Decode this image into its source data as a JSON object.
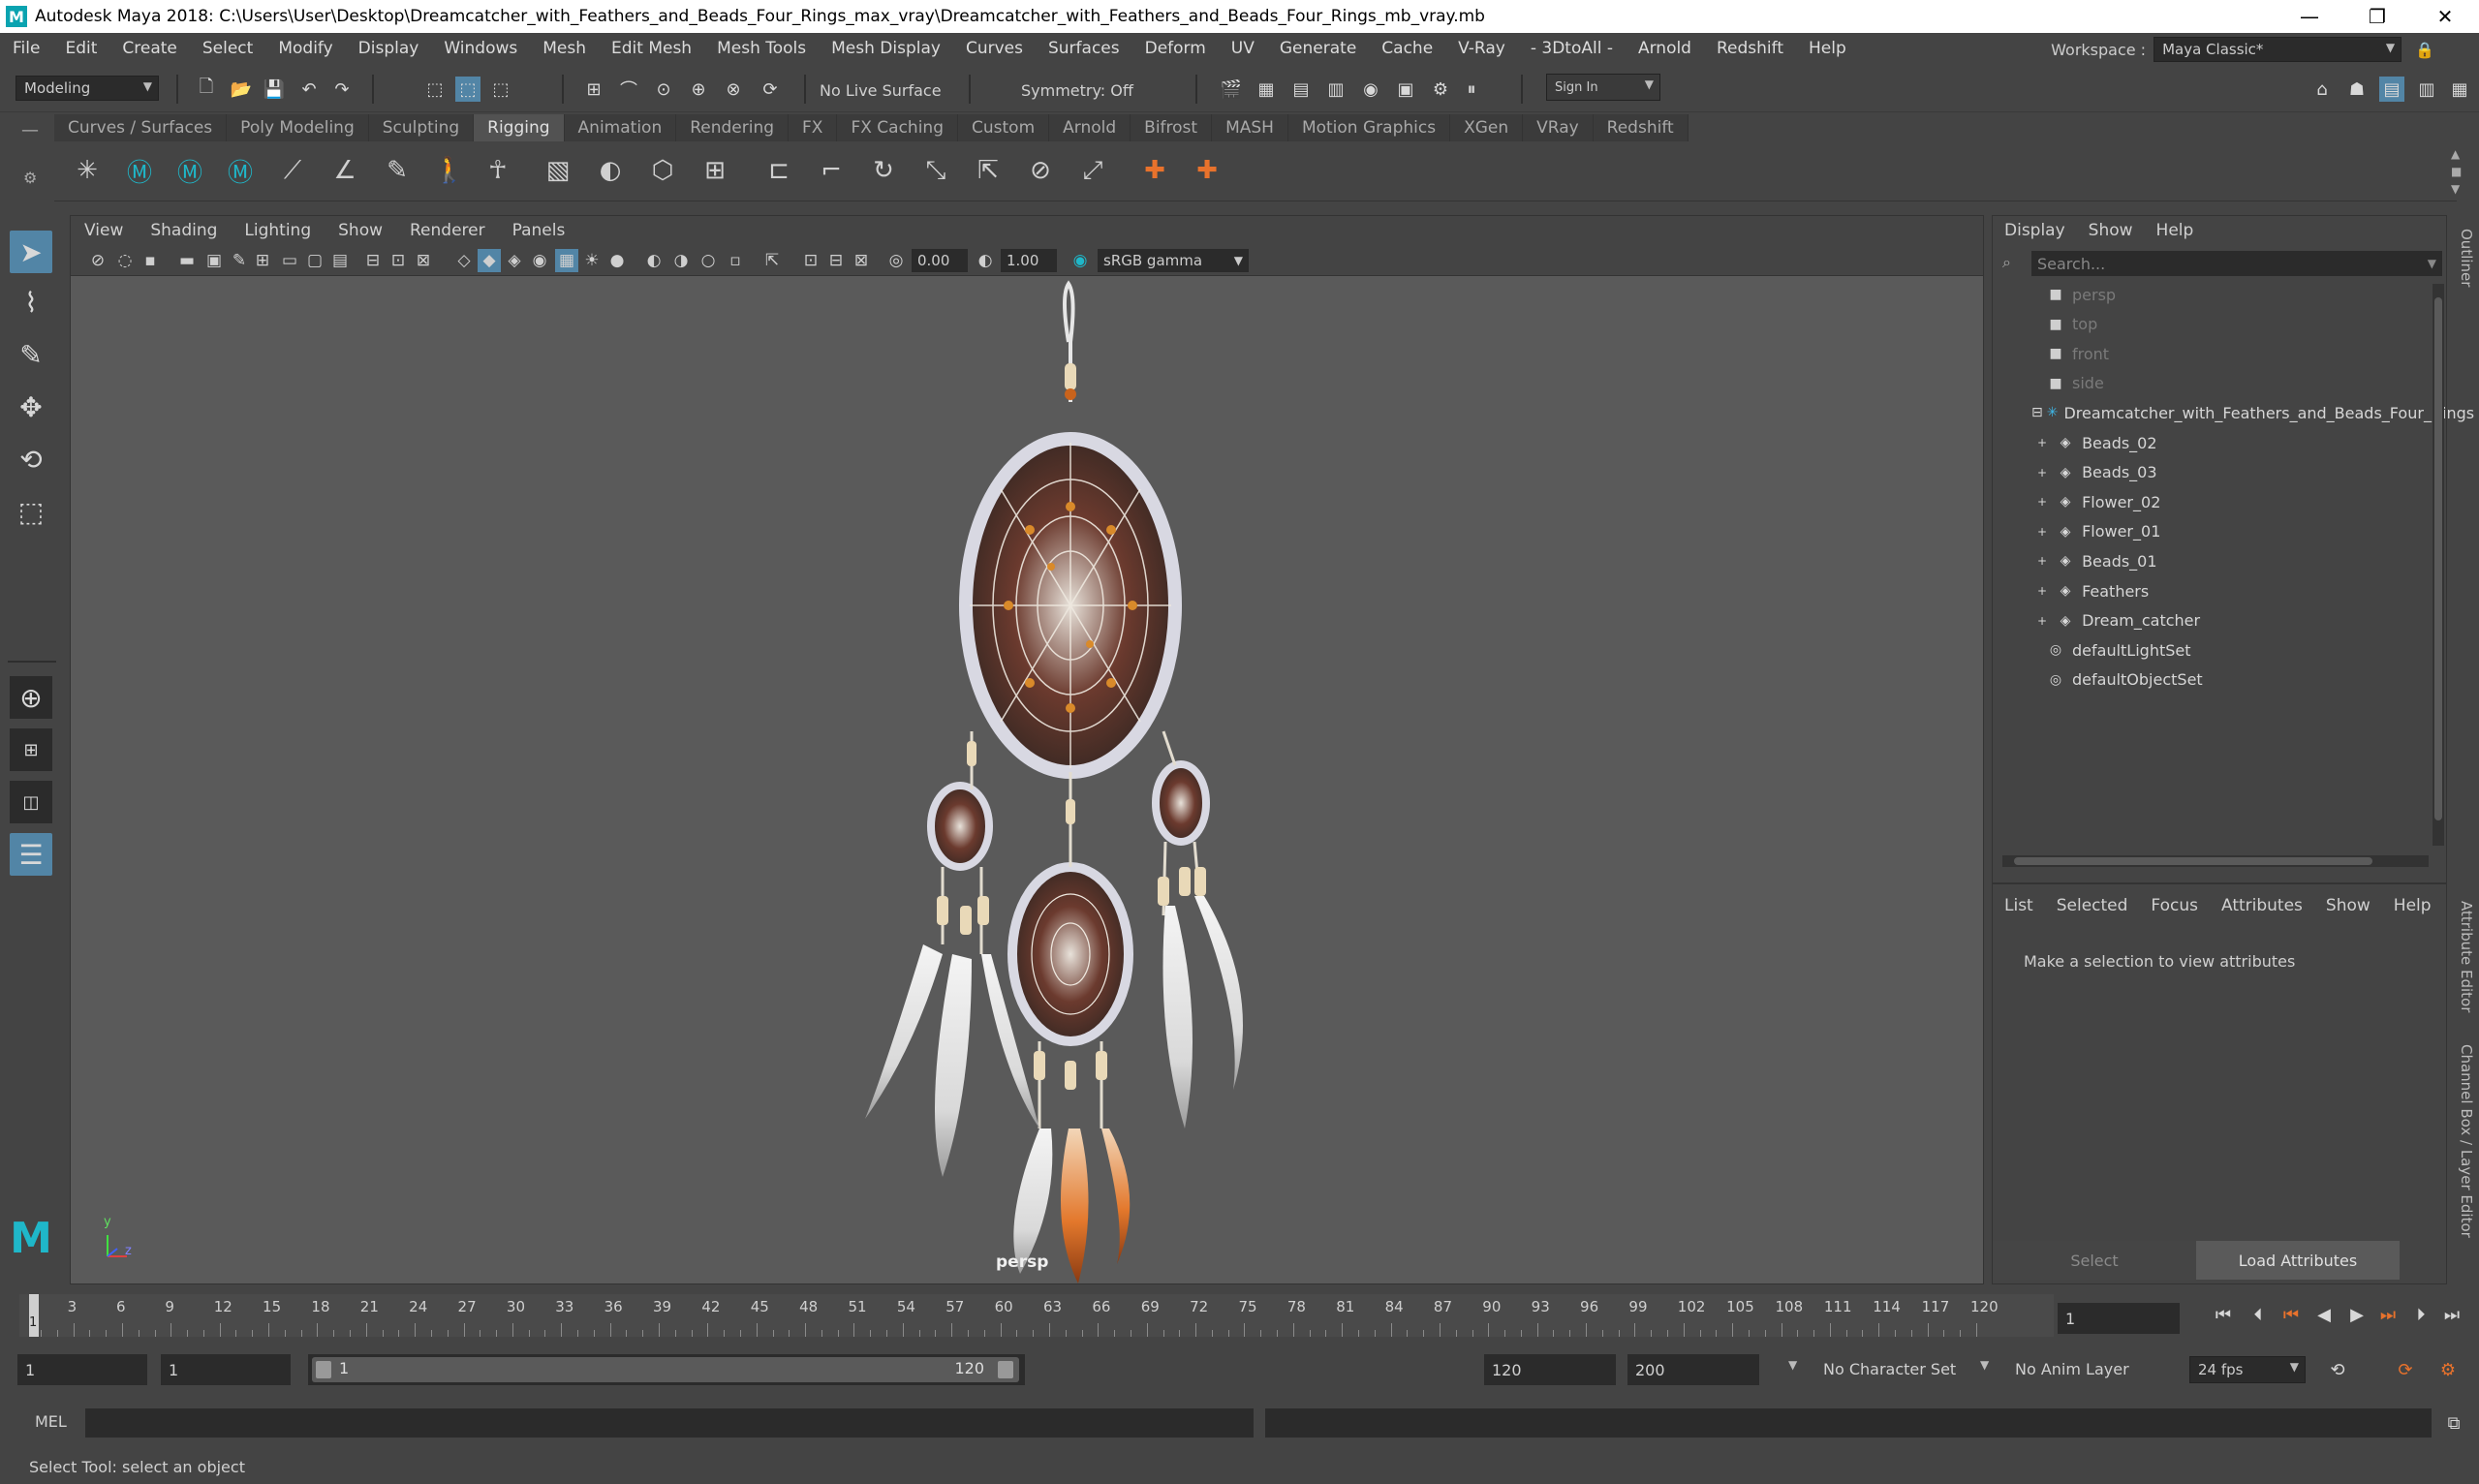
{
  "window": {
    "title": "Autodesk Maya 2018: C:\\Users\\User\\Desktop\\Dreamcatcher_with_Feathers_and_Beads_Four_Rings_max_vray\\Dreamcatcher_with_Feathers_and_Beads_Four_Rings_mb_vray.mb",
    "logo": "M",
    "minimize": "—",
    "maximize": "❐",
    "close": "✕"
  },
  "menubar": [
    "File",
    "Edit",
    "Create",
    "Select",
    "Modify",
    "Display",
    "Windows",
    "Mesh",
    "Edit Mesh",
    "Mesh Tools",
    "Mesh Display",
    "Curves",
    "Surfaces",
    "Deform",
    "UV",
    "Generate",
    "Cache",
    "V-Ray",
    "- 3DtoAll -",
    "Arnold",
    "Redshift",
    "Help"
  ],
  "workspace": {
    "label": "Workspace :",
    "value": "Maya Classic*"
  },
  "statusline": {
    "mode": "Modeling",
    "live_surface": "No Live Surface",
    "symmetry": "Symmetry: Off",
    "sign_in": "Sign In"
  },
  "shelf_tabs": [
    "Curves / Surfaces",
    "Poly Modeling",
    "Sculpting",
    "Rigging",
    "Animation",
    "Rendering",
    "FX",
    "FX Caching",
    "Custom",
    "Arnold",
    "Bifrost",
    "MASH",
    "Motion Graphics",
    "XGen",
    "VRay",
    "Redshift"
  ],
  "shelf_active": "Rigging",
  "viewport": {
    "menu": [
      "View",
      "Shading",
      "Lighting",
      "Show",
      "Renderer",
      "Panels"
    ],
    "exposure": "0.00",
    "gamma": "1.00",
    "colorspace": "sRGB gamma",
    "camera": "persp",
    "axis_y": "y",
    "axis_z": "z"
  },
  "outliner": {
    "menu": [
      "Display",
      "Show",
      "Help"
    ],
    "search_placeholder": "Search...",
    "items": [
      {
        "label": "persp",
        "type": "camera",
        "dim": true
      },
      {
        "label": "top",
        "type": "camera",
        "dim": true
      },
      {
        "label": "front",
        "type": "camera",
        "dim": true
      },
      {
        "label": "side",
        "type": "camera",
        "dim": true
      },
      {
        "label": "Dreamcatcher_with_Feathers_and_Beads_Four_Rings",
        "type": "group",
        "dim": false
      },
      {
        "label": "Beads_02",
        "type": "mesh",
        "dim": false
      },
      {
        "label": "Beads_03",
        "type": "mesh",
        "dim": false
      },
      {
        "label": "Flower_02",
        "type": "mesh",
        "dim": false
      },
      {
        "label": "Flower_01",
        "type": "mesh",
        "dim": false
      },
      {
        "label": "Beads_01",
        "type": "mesh",
        "dim": false
      },
      {
        "label": "Feathers",
        "type": "mesh",
        "dim": false
      },
      {
        "label": "Dream_catcher",
        "type": "mesh",
        "dim": false
      },
      {
        "label": "defaultLightSet",
        "type": "set",
        "dim": false
      },
      {
        "label": "defaultObjectSet",
        "type": "set",
        "dim": false
      }
    ]
  },
  "attribute_editor": {
    "menu": [
      "List",
      "Selected",
      "Focus",
      "Attributes",
      "Show",
      "Help"
    ],
    "message": "Make a selection to view attributes",
    "select_button": "Select",
    "load_button": "Load Attributes"
  },
  "side_tabs": {
    "outliner": "Outliner",
    "attribute_editor": "Attribute Editor",
    "channel_box": "Channel Box / Layer Editor"
  },
  "timeline": {
    "ticks": [
      "3",
      "6",
      "9",
      "12",
      "15",
      "18",
      "21",
      "24",
      "27",
      "30",
      "33",
      "36",
      "39",
      "42",
      "45",
      "48",
      "51",
      "54",
      "57",
      "60",
      "63",
      "66",
      "69",
      "72",
      "75",
      "78",
      "81",
      "84",
      "87",
      "90",
      "93",
      "96",
      "99",
      "102",
      "105",
      "108",
      "111",
      "114",
      "117",
      "120"
    ],
    "current_marker": "1",
    "current_frame": "1"
  },
  "range": {
    "start": "1",
    "playback_start": "1",
    "slider_start": "1",
    "slider_end": "120",
    "playback_end": "120",
    "end": "200",
    "character_set": "No Character Set",
    "anim_layer": "No Anim Layer",
    "fps": "24 fps"
  },
  "command_line": {
    "label": "MEL"
  },
  "help_line": "Select Tool: select an object"
}
